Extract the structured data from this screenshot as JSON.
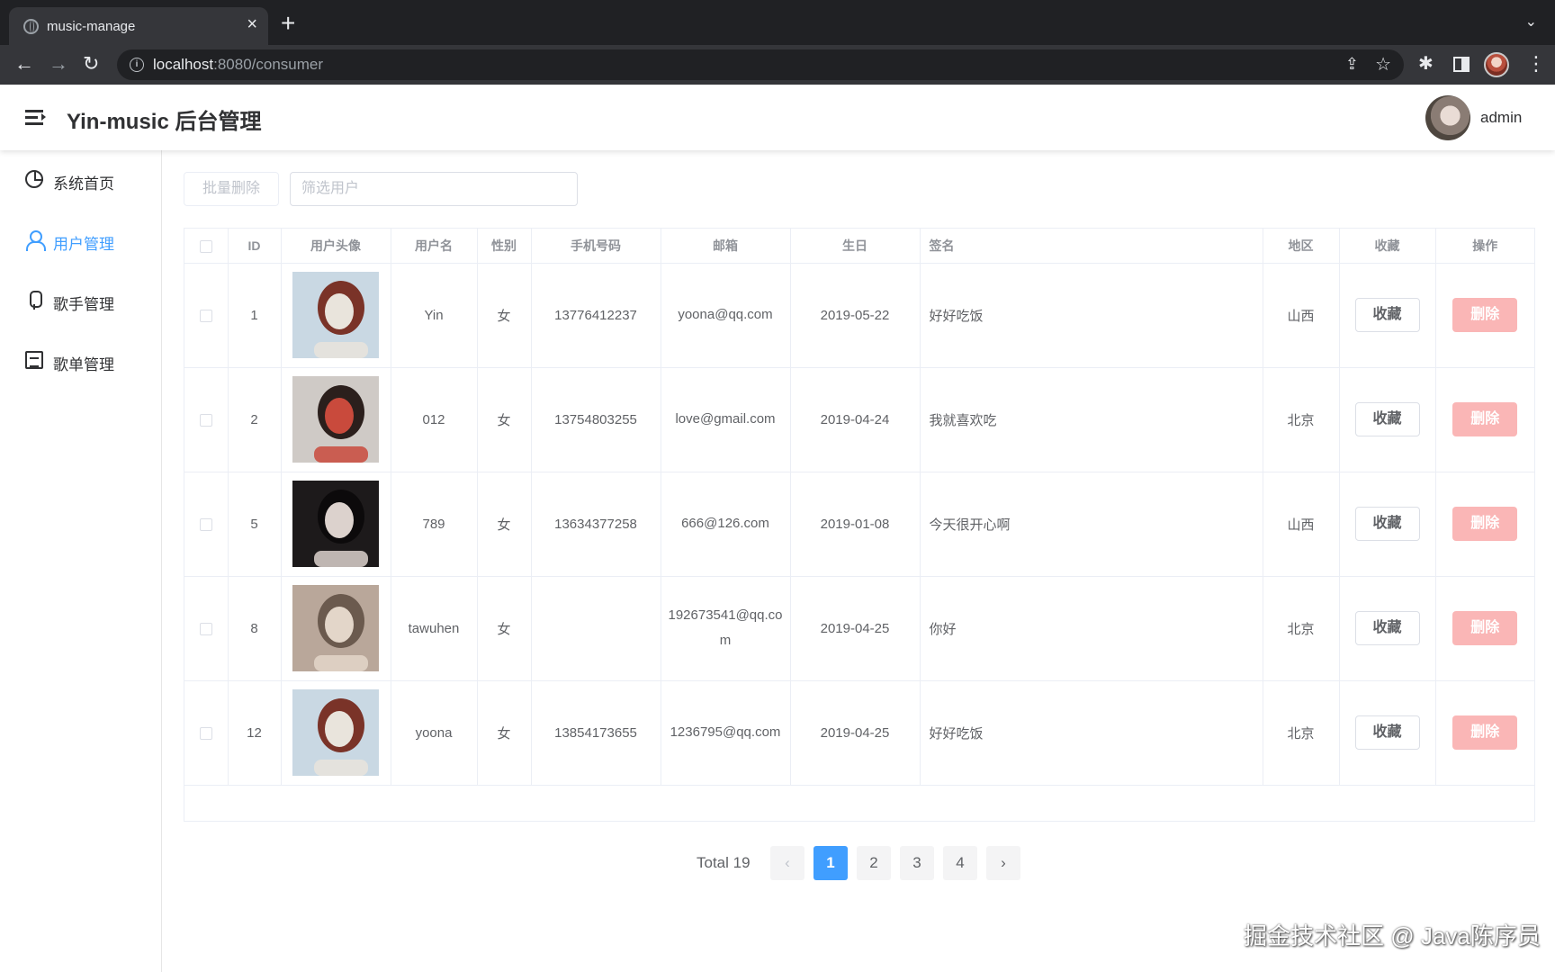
{
  "browser": {
    "tab_title": "music-manage",
    "url_host": "localhost",
    "url_rest": ":8080/consumer",
    "icons": {
      "back": "←",
      "forward": "→",
      "reload": "↻",
      "close": "×",
      "new_tab": "+",
      "tab_list": "⌄",
      "share": "⇪",
      "star": "☆",
      "info": "i",
      "extensions": "✱",
      "menu": "⋮"
    }
  },
  "header": {
    "title": "Yin-music 后台管理",
    "user_name": "admin"
  },
  "sidebar": {
    "items": [
      {
        "label": "系统首页",
        "icon": "pie-chart-icon",
        "active": false
      },
      {
        "label": "用户管理",
        "icon": "user-icon",
        "active": true
      },
      {
        "label": "歌手管理",
        "icon": "microphone-icon",
        "active": false
      },
      {
        "label": "歌单管理",
        "icon": "document-icon",
        "active": false
      }
    ]
  },
  "toolbar": {
    "batch_delete_label": "批量删除",
    "search_placeholder": "筛选用户"
  },
  "table": {
    "columns": [
      "",
      "ID",
      "用户头像",
      "用户名",
      "性别",
      "手机号码",
      "邮箱",
      "生日",
      "签名",
      "地区",
      "收藏",
      "操作"
    ],
    "fav_label": "收藏",
    "delete_label": "删除",
    "rows": [
      {
        "id": "1",
        "username": "Yin",
        "sex": "女",
        "phone": "13776412237",
        "email": "yoona@qq.com",
        "birth": "2019-05-22",
        "signature": "好好吃饭",
        "location": "山西",
        "avatar_colors": [
          "#c9d8e3",
          "#e9e4dc",
          "#7a3328"
        ]
      },
      {
        "id": "2",
        "username": "012",
        "sex": "女",
        "phone": "13754803255",
        "email": "love@gmail.com",
        "birth": "2019-04-24",
        "signature": "我就喜欢吃",
        "location": "北京",
        "avatar_colors": [
          "#cfcac6",
          "#c94a3c",
          "#2b1f1c"
        ]
      },
      {
        "id": "5",
        "username": "789",
        "sex": "女",
        "phone": "13634377258",
        "email": "666@126.com",
        "birth": "2019-01-08",
        "signature": "今天很开心啊",
        "location": "山西",
        "avatar_colors": [
          "#1d1a1b",
          "#dcd2cd",
          "#0c0a0b"
        ]
      },
      {
        "id": "8",
        "username": "tawuhen",
        "sex": "女",
        "phone": "",
        "email": "192673541@qq.com",
        "birth": "2019-04-25",
        "signature": "你好",
        "location": "北京",
        "avatar_colors": [
          "#b9a79a",
          "#e3d6c9",
          "#6b5a4e"
        ]
      },
      {
        "id": "12",
        "username": "yoona",
        "sex": "女",
        "phone": "13854173655",
        "email": "1236795@qq.com",
        "birth": "2019-04-25",
        "signature": "好好吃饭",
        "location": "北京",
        "avatar_colors": [
          "#c9d8e3",
          "#e9e4dc",
          "#7a3328"
        ]
      }
    ]
  },
  "pagination": {
    "total_label": "Total 19",
    "prev": "‹",
    "next": "›",
    "pages": [
      "1",
      "2",
      "3",
      "4"
    ],
    "current": "1"
  },
  "watermark": "掘金技术社区 @ Java陈序员",
  "colors": {
    "primary": "#409eff",
    "danger_light": "#fab6b6",
    "border": "#ebeef5"
  }
}
